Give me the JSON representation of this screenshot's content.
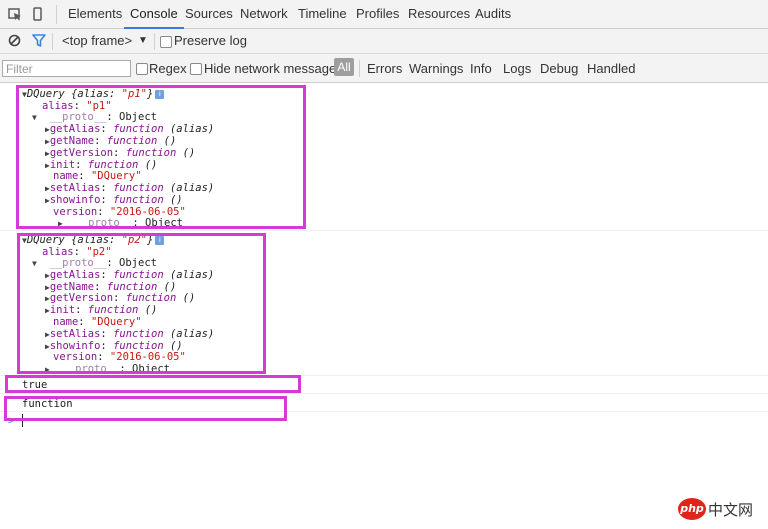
{
  "tabs": [
    "Elements",
    "Console",
    "Sources",
    "Network",
    "Timeline",
    "Profiles",
    "Resources",
    "Audits"
  ],
  "active_tab": "Console",
  "toolbar": {
    "frame_label": "<top frame>",
    "frame_arrow": "▼",
    "preserve_log": "Preserve log"
  },
  "filterbar": {
    "filter_placeholder": "Filter",
    "regex": "Regex",
    "hide_network": "Hide network messages",
    "levels": [
      "All",
      "Errors",
      "Warnings",
      "Info",
      "Logs",
      "Debug",
      "Handled"
    ]
  },
  "objects": [
    {
      "header_name": "DQuery",
      "header_open": "{alias: ",
      "header_value": "\"p1\"",
      "header_close": "}",
      "alias_key": "alias",
      "alias_value": "\"p1\"",
      "proto_key": "__proto__",
      "proto_type": ": Object",
      "members": [
        {
          "key": "getAlias",
          "kind": "function",
          "sig": "(alias)"
        },
        {
          "key": "getName",
          "kind": "function",
          "sig": "()"
        },
        {
          "key": "getVersion",
          "kind": "function",
          "sig": "()"
        },
        {
          "key": "init",
          "kind": "function",
          "sig": "()"
        },
        {
          "key": "name",
          "kind": "string",
          "value": "\"DQuery\""
        },
        {
          "key": "setAlias",
          "kind": "function",
          "sig": "(alias)"
        },
        {
          "key": "showinfo",
          "kind": "function",
          "sig": "()"
        },
        {
          "key": "version",
          "kind": "string",
          "value": "\"2016-06-05\""
        }
      ],
      "inner_proto_key": "__proto__",
      "inner_proto_type": ": Object"
    },
    {
      "header_name": "DQuery",
      "header_open": "{alias: ",
      "header_value": "\"p2\"",
      "header_close": "}",
      "alias_key": "alias",
      "alias_value": "\"p2\"",
      "proto_key": "__proto__",
      "proto_type": ": Object",
      "members": [
        {
          "key": "getAlias",
          "kind": "function",
          "sig": "(alias)"
        },
        {
          "key": "getName",
          "kind": "function",
          "sig": "()"
        },
        {
          "key": "getVersion",
          "kind": "function",
          "sig": "()"
        },
        {
          "key": "init",
          "kind": "function",
          "sig": "()"
        },
        {
          "key": "name",
          "kind": "string",
          "value": "\"DQuery\""
        },
        {
          "key": "setAlias",
          "kind": "function",
          "sig": "(alias)"
        },
        {
          "key": "showinfo",
          "kind": "function",
          "sig": "()"
        },
        {
          "key": "version",
          "kind": "string",
          "value": "\"2016-06-05\""
        }
      ],
      "inner_proto_key": "__proto__",
      "inner_proto_type": ": Object"
    }
  ],
  "outputs": [
    "true",
    "function"
  ],
  "prompt_symbol": ">",
  "watermark": {
    "logo": "php",
    "text": "中文网"
  },
  "colors": {
    "highlight": "#d63ad6",
    "active_tab_underline": "#3879d9",
    "filter_icon": "#3b84e6"
  }
}
